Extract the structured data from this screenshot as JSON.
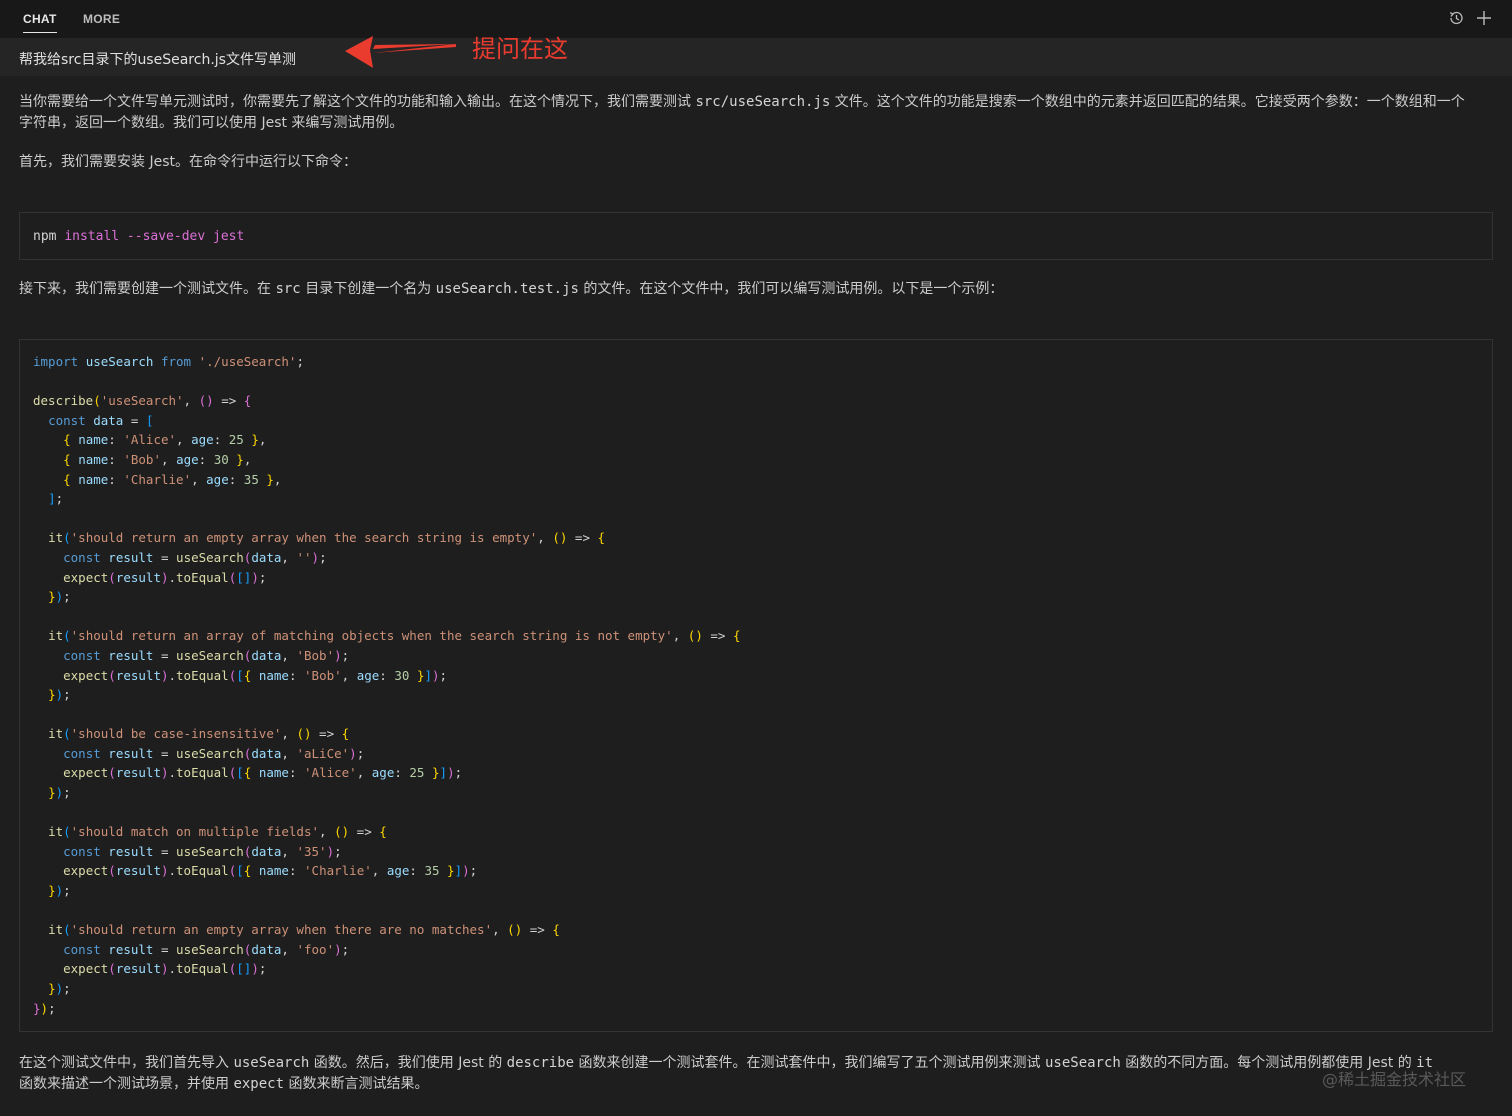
{
  "tabs": {
    "chat": "CHAT",
    "more": "MORE"
  },
  "question": "帮我给src目录下的useSearch.js文件写单测",
  "annotation": "提问在这",
  "para1": {
    "a": "当你需要给一个文件写单元测试时，你需要先了解这个文件的功能和输入输出。在这个情况下，我们需要测试 ",
    "code": "src/useSearch.js",
    "b": " 文件。这个文件的功能是搜索一个数组中的元素并返回匹配的结果。它接受两个参数：一个数组和一个",
    "line2": "字符串，返回一个数组。我们可以使用 Jest 来编写测试用例。"
  },
  "para2": "首先，我们需要安装 Jest。在命令行中运行以下命令：",
  "install_cmd": {
    "npm": "npm",
    "rest": "install --save-dev jest"
  },
  "para3": {
    "a": "接下来，我们需要创建一个测试文件。在 ",
    "code1": "src",
    "b": " 目录下创建一个名为 ",
    "code2": "useSearch.test.js",
    "c": " 的文件。在这个文件中，我们可以编写测试用例。以下是一个示例："
  },
  "code_lines": [
    "import useSearch from './useSearch';",
    "",
    "describe('useSearch', () => {",
    "  const data = [",
    "    { name: 'Alice', age: 25 },",
    "    { name: 'Bob', age: 30 },",
    "    { name: 'Charlie', age: 35 },",
    "  ];",
    "",
    "  it('should return an empty array when the search string is empty', () => {",
    "    const result = useSearch(data, '');",
    "    expect(result).toEqual([]);",
    "  });",
    "",
    "  it('should return an array of matching objects when the search string is not empty', () => {",
    "    const result = useSearch(data, 'Bob');",
    "    expect(result).toEqual([{ name: 'Bob', age: 30 }]);",
    "  });",
    "",
    "  it('should be case-insensitive', () => {",
    "    const result = useSearch(data, 'aLiCe');",
    "    expect(result).toEqual([{ name: 'Alice', age: 25 }]);",
    "  });",
    "",
    "  it('should match on multiple fields', () => {",
    "    const result = useSearch(data, '35');",
    "    expect(result).toEqual([{ name: 'Charlie', age: 35 }]);",
    "  });",
    "",
    "  it('should return an empty array when there are no matches', () => {",
    "    const result = useSearch(data, 'foo');",
    "    expect(result).toEqual([]);",
    "  });",
    "});"
  ],
  "para4": {
    "a": "在这个测试文件中，我们首先导入 ",
    "code1": "useSearch",
    "b": " 函数。然后，我们使用 Jest 的 ",
    "code2": "describe",
    "c": " 函数来创建一个测试套件。在测试套件中，我们编写了五个测试用例来测试 ",
    "code3": "useSearch",
    "d": " 函数的不同方面。每个测试用例都使用 Jest 的 ",
    "code4": "it",
    "line2a": "函数来描述一个测试场景，并使用 ",
    "code5": "expect",
    "line2b": " 函数来断言测试结果。"
  },
  "watermark": "@稀土掘金技术社区",
  "colors": {
    "background": "#1e1e1e",
    "annotation": "#e93b2e"
  }
}
